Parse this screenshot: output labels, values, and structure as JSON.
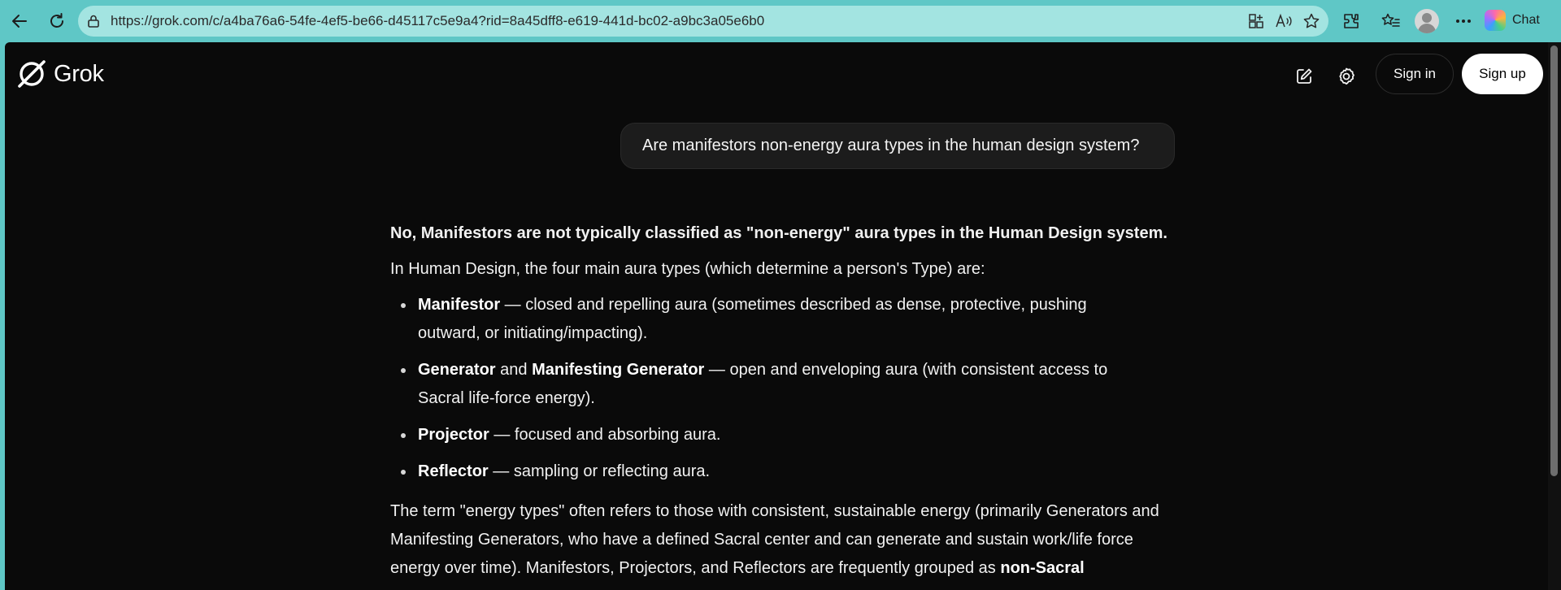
{
  "browser": {
    "url": "https://grok.com/c/a4ba76a6-54fe-4ef5-be66-d45117c5e9a4?rid=8a45dff8-e619-441d-bc02-a9bc3a05e6b0",
    "chat_label": "Chat",
    "icons": [
      "back-icon",
      "refresh-icon",
      "lock-icon",
      "app-view-icon",
      "read-aloud-icon",
      "favorite-star-icon",
      "extensions-icon",
      "favorites-icon",
      "profile-icon",
      "more-icon",
      "copilot-icon"
    ]
  },
  "header": {
    "logo_text": "Grok",
    "signin_label": "Sign in",
    "signup_label": "Sign up",
    "icons": [
      "new-chat-icon",
      "settings-icon"
    ]
  },
  "conversation": {
    "user_message": "Are manifestors non-energy aura types in the human design system?",
    "answer": {
      "lead": "No, Manifestors are not typically classified as \"non-energy\" aura types in the Human Design system.",
      "intro": "In Human Design, the four main aura types (which determine a person's Type) are:",
      "items": [
        {
          "bold1": "Manifestor",
          "mid": "",
          "bold2": "",
          "rest": " — closed and repelling aura (sometimes described as dense, protective, pushing outward, or initiating/impacting)."
        },
        {
          "bold1": "Generator",
          "mid": " and ",
          "bold2": "Manifesting Generator",
          "rest": " — open and enveloping aura (with consistent access to Sacral life-force energy)."
        },
        {
          "bold1": "Projector",
          "mid": "",
          "bold2": "",
          "rest": " — focused and absorbing aura."
        },
        {
          "bold1": "Reflector",
          "mid": "",
          "bold2": "",
          "rest": " — sampling or reflecting aura."
        }
      ],
      "para_text": "The term \"energy types\" often refers to those with consistent, sustainable energy (primarily Generators and Manifesting Generators, who have a defined Sacral center and can generate and sustain work/life force energy over time). Manifestors, Projectors, and Reflectors are frequently grouped as ",
      "para_bold": "non-Sacral"
    }
  }
}
